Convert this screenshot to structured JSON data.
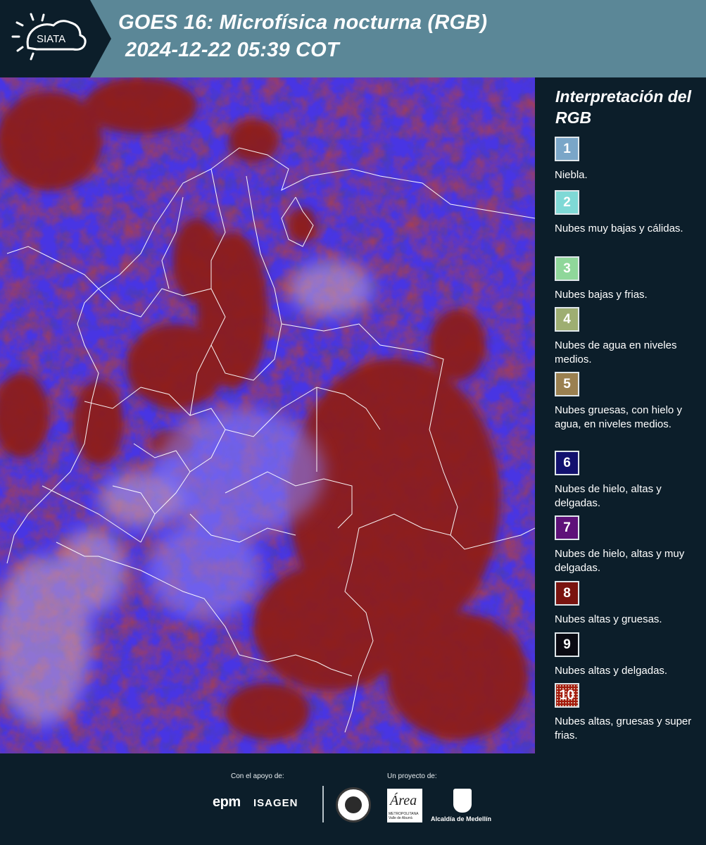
{
  "header": {
    "logo_text": "SIATA",
    "title_line1": "GOES 16: Microfísica nocturna (RGB)",
    "title_line2": "2024-12-22 05:39 COT"
  },
  "legend": {
    "title": "Interpretación del RGB",
    "items": [
      {
        "number": "1",
        "color": "#7aa6c8",
        "desc": "Niebla."
      },
      {
        "number": "2",
        "color": "#7fd9d6",
        "desc": "Nubes muy bajas y cálidas."
      },
      {
        "number": "3",
        "color": "#8fd79a",
        "desc": "Nubes bajas y frias."
      },
      {
        "number": "4",
        "color": "#9eae72",
        "desc": "Nubes de agua en niveles medios."
      },
      {
        "number": "5",
        "color": "#9a8050",
        "desc": "Nubes gruesas, con hielo y agua, en niveles medios."
      },
      {
        "number": "6",
        "color": "#12116e",
        "desc": "Nubes de hielo, altas y delgadas."
      },
      {
        "number": "7",
        "color": "#5e1179",
        "desc": "Nubes de hielo, altas y muy delgadas."
      },
      {
        "number": "8",
        "color": "#7a1410",
        "desc": "Nubes altas y gruesas."
      },
      {
        "number": "9",
        "color": "#0a0a12",
        "desc": "Nubes altas y delgadas."
      },
      {
        "number": "10",
        "color": "#a41a0c",
        "desc": "Nubes altas, gruesas y super frias."
      }
    ]
  },
  "footer": {
    "support_label": "Con el apoyo de:",
    "project_label": "Un proyecto de:",
    "epm": "epm",
    "isagen": "ISAGEN",
    "area_logo": "Área",
    "area_sub": "METROPOLITANA Valle de Aburrá",
    "alcaldia": "Alcaldía de Medellín"
  }
}
